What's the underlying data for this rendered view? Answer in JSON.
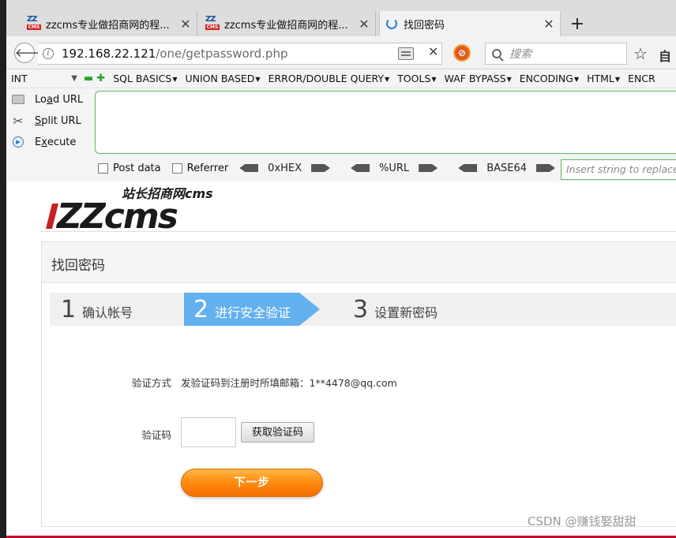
{
  "browser": {
    "tabs": [
      {
        "title": "zzcms专业做招商网的程...",
        "favicon_zz": "ZZ",
        "favicon_cms": "CMS",
        "active": false
      },
      {
        "title": "zzcms专业做招商网的程...",
        "favicon_zz": "ZZ",
        "favicon_cms": "CMS",
        "active": false
      },
      {
        "title": "找回密码",
        "active": true
      }
    ],
    "close_glyph": "✕",
    "new_tab_glyph": "+",
    "url_host": "192.168.22.121",
    "url_path": "/one/getpassword.php",
    "search_placeholder": "搜索",
    "back_glyph": "🡐",
    "stop_glyph": "✕",
    "star_glyph": "☆",
    "library_glyph": "自"
  },
  "hackbar": {
    "select_value": "INT",
    "menus": [
      "SQL BASICS",
      "UNION BASED",
      "ERROR/DOUBLE QUERY",
      "TOOLS",
      "WAF BYPASS",
      "ENCODING",
      "HTML",
      "ENCR"
    ],
    "load_url": {
      "pre": "Lo",
      "u": "a",
      "post": "d URL"
    },
    "split_url": {
      "pre": "",
      "u": "S",
      "post": "plit URL"
    },
    "execute": {
      "pre": "E",
      "u": "x",
      "post": "ecute"
    },
    "post_data": "Post data",
    "referrer": "Referrer",
    "hex": "0xHEX",
    "url": "%URL",
    "base64": "BASE64",
    "replace_placeholder": "Insert string to replace"
  },
  "page": {
    "logo_text": "ZZcms",
    "logo_sub": "站长招商网cms",
    "panel_title": "找回密码",
    "steps": [
      {
        "num": "1",
        "label": "确认帐号"
      },
      {
        "num": "2",
        "label": "进行安全验证"
      },
      {
        "num": "3",
        "label": "设置新密码"
      }
    ],
    "verify_method_label": "验证方式",
    "verify_method_value": "发验证码到注册时所填邮箱：1**4478@qq.com",
    "code_label": "验证码",
    "get_code_button": "获取验证码",
    "next_button": "下一步",
    "watermark": "CSDN @赚钱娶甜甜"
  },
  "colors": {
    "step_active": "#63b0ee",
    "next_button": "#ff8a0c",
    "hackbar_border": "#5cb85c",
    "logo_dark": "#1a1a1a",
    "logo_red": "#c62020"
  }
}
